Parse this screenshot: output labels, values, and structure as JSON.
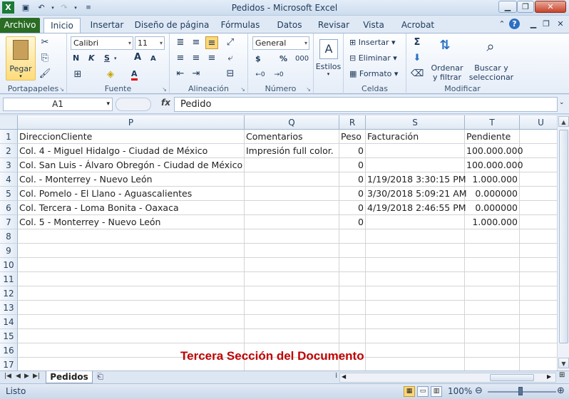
{
  "window": {
    "title": "Pedidos  -  Microsoft Excel",
    "excel_icon": "X",
    "qa_icons": [
      "save-icon",
      "undo-icon",
      "redo-icon",
      "customize-icon"
    ],
    "controls": [
      "minimize-icon",
      "restore-icon",
      "close-icon"
    ]
  },
  "tabs": {
    "file": "Archivo",
    "items": [
      "Inicio",
      "Insertar",
      "Diseño de página",
      "Fórmulas",
      "Datos",
      "Revisar",
      "Vista",
      "Acrobat"
    ],
    "active": "Inicio"
  },
  "ribbon": {
    "clipboard": {
      "label": "Portapapeles",
      "paste": "Pegar"
    },
    "font": {
      "label": "Fuente",
      "family": "Calibri",
      "size": "11",
      "bold": "N",
      "italic": "K",
      "underline": "S",
      "grow": "A",
      "shrink": "A",
      "color_letter": "A"
    },
    "alignment": {
      "label": "Alineación"
    },
    "number": {
      "label": "Número",
      "format": "General",
      "currency": "$",
      "percent": "%",
      "thousands": "000"
    },
    "styles": {
      "label": "Estilos"
    },
    "cells": {
      "label": "Celdas",
      "insert": "Insertar",
      "delete": "Eliminar",
      "format": "Formato"
    },
    "editing": {
      "label": "Modificar",
      "sort_line1": "Ordenar",
      "sort_line2": "y filtrar",
      "find_line1": "Buscar y",
      "find_line2": "seleccionar"
    }
  },
  "formula_bar": {
    "cell_ref": "A1",
    "fx": "fx",
    "value": "Pedido"
  },
  "sheet": {
    "columns": [
      "P",
      "Q",
      "R",
      "S",
      "T",
      "U"
    ],
    "rows": [
      [
        "DireccionCliente",
        "Comentarios",
        "Peso",
        "Facturación",
        "Pendiente",
        ""
      ],
      [
        "Col. 4 - Miguel Hidalgo - Ciudad de México",
        "Impresión full color.",
        "0",
        "",
        "100.000.000",
        ""
      ],
      [
        "Col. San Luis - Álvaro Obregón - Ciudad de México",
        "",
        "0",
        "",
        "100.000.000",
        ""
      ],
      [
        "Col.  - Monterrey - Nuevo León",
        "",
        "0",
        "1/19/2018 3:30:15 PM",
        "1.000.000",
        ""
      ],
      [
        "Col. Pomelo - El Llano - Aguascalientes",
        "",
        "0",
        "3/30/2018 5:09:21 AM",
        "0.000000",
        ""
      ],
      [
        "Col. Tercera - Loma Bonita - Oaxaca",
        "",
        "0",
        "4/19/2018 2:46:55 PM",
        "0.000000",
        ""
      ],
      [
        "Col. 5 - Monterrey - Nuevo León",
        "",
        "0",
        "",
        "1.000.000",
        ""
      ],
      [
        "",
        "",
        "",
        "",
        "",
        ""
      ],
      [
        "",
        "",
        "",
        "",
        "",
        ""
      ],
      [
        "",
        "",
        "",
        "",
        "",
        ""
      ],
      [
        "",
        "",
        "",
        "",
        "",
        ""
      ],
      [
        "",
        "",
        "",
        "",
        "",
        ""
      ],
      [
        "",
        "",
        "",
        "",
        "",
        ""
      ],
      [
        "",
        "",
        "",
        "",
        "",
        ""
      ],
      [
        "",
        "",
        "",
        "",
        "",
        ""
      ],
      [
        "",
        "",
        "",
        "",
        "",
        ""
      ],
      [
        "",
        "",
        "",
        "",
        "",
        ""
      ]
    ],
    "row_numbers": [
      "1",
      "2",
      "3",
      "4",
      "5",
      "6",
      "7",
      "8",
      "9",
      "10",
      "11",
      "12",
      "13",
      "14",
      "15",
      "16",
      "17"
    ]
  },
  "caption": "Tercera Sección del Documento",
  "sheet_tabs": {
    "active": "Pedidos"
  },
  "status": {
    "ready": "Listo",
    "zoom": "100%"
  }
}
